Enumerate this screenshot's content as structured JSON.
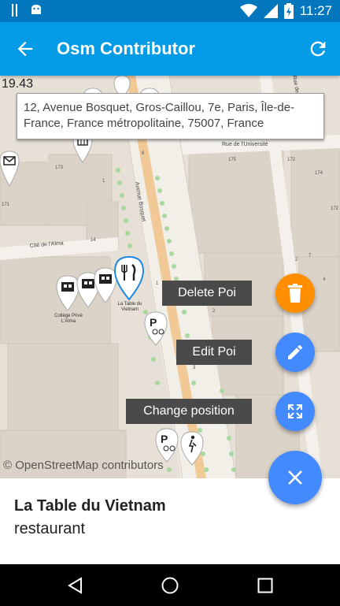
{
  "status_bar": {
    "time": "11:27",
    "icons": [
      "sim-icon",
      "android-debug-icon",
      "wifi-icon",
      "signal-icon",
      "battery-icon"
    ]
  },
  "app_bar": {
    "title": "Osm Contributor",
    "icons": [
      "back-arrow-icon",
      "refresh-icon"
    ]
  },
  "map": {
    "zoom_level": "19.43",
    "address": "12, Avenue Bosquet, Gros-Caillou, 7e, Paris, Île-de-France, France métropolitaine, 75007, France",
    "attribution": "© OpenStreetMap contributors",
    "poi_label": "La Table du Vietnam",
    "school_label": "Collège Privé L'Alma",
    "street_labels": {
      "avenue_bosquet": "Avenue Bosquet",
      "cite_de_lalma": "Cité de l'Alma",
      "rue_de_luniversite": "Rue de l'Université",
      "rue_partial": "Rue de"
    },
    "building_numbers": [
      "173",
      "175",
      "172",
      "171",
      "174",
      "170",
      "172",
      "2",
      "1",
      "3",
      "14",
      "20",
      "2",
      "4",
      "1",
      "7",
      "6"
    ]
  },
  "actions": {
    "delete_label": "Delete Poi",
    "edit_label": "Edit Poi",
    "move_label": "Change position"
  },
  "colors": {
    "primary": "#039be5",
    "primary_dark": "#0277bd",
    "delete_fab": "#ff8f00",
    "action_fab": "#448aff"
  },
  "sheet": {
    "name": "La Table du Vietnam",
    "type": "restaurant"
  },
  "nav_bar": {
    "icons": [
      "back-triangle-icon",
      "home-circle-icon",
      "recents-square-icon"
    ]
  }
}
